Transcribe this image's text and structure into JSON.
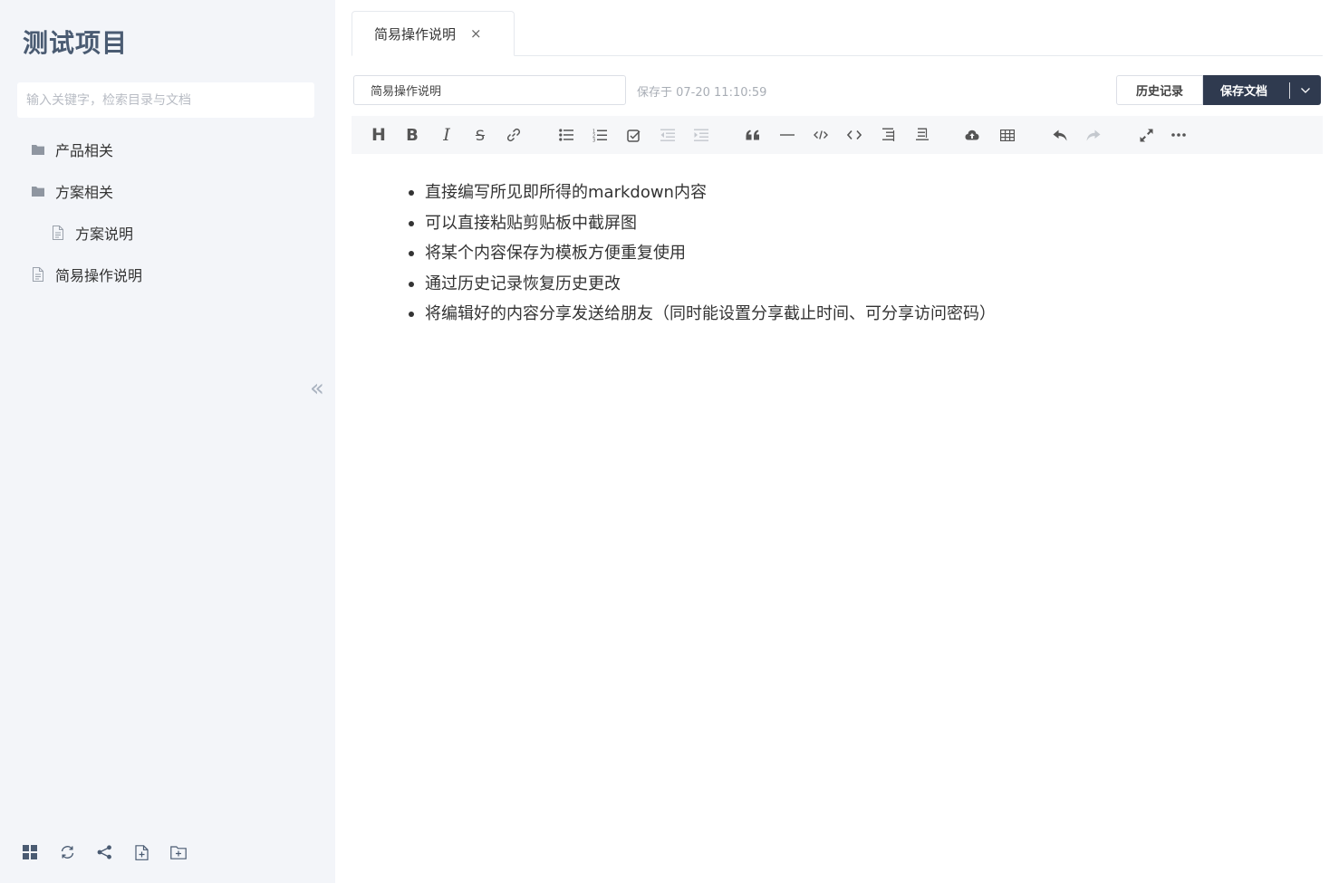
{
  "sidebar": {
    "project_title": "测试项目",
    "search_placeholder": "输入关键字，检索目录与文档",
    "tree": [
      {
        "label": "产品相关",
        "type": "folder"
      },
      {
        "label": "方案相关",
        "type": "folder"
      },
      {
        "label": "方案说明",
        "type": "document"
      },
      {
        "label": "简易操作说明",
        "type": "document"
      }
    ],
    "collapse_glyph": "«",
    "bottom_tools": [
      "grid-icon",
      "refresh-icon",
      "share-icon",
      "new-document-icon",
      "new-folder-icon"
    ]
  },
  "tabs": [
    {
      "label": "简易操作说明",
      "close_glyph": "×"
    }
  ],
  "editor": {
    "title_value": "简易操作说明",
    "save_status": "保存于 07-20 11:10:59",
    "history_label": "历史记录",
    "save_label": "保存文档",
    "toolbar": {
      "heading": "H",
      "bold": "B",
      "italic": "I",
      "strikethrough": "S"
    }
  },
  "content": {
    "items": [
      "直接编写所见即所得的markdown内容",
      "可以直接粘贴剪贴板中截屏图",
      "将某个内容保存为模板方便重复使用",
      "通过历史记录恢复历史更改",
      "将编辑好的内容分享发送给朋友（同时能设置分享截止时间、可分享访问密码）"
    ]
  },
  "colors": {
    "sidebar_bg": "#f3f5f9",
    "title_color": "#4a5b72",
    "save_button_bg": "#2f3a4f",
    "toolbar_bg": "#f6f7f9"
  }
}
